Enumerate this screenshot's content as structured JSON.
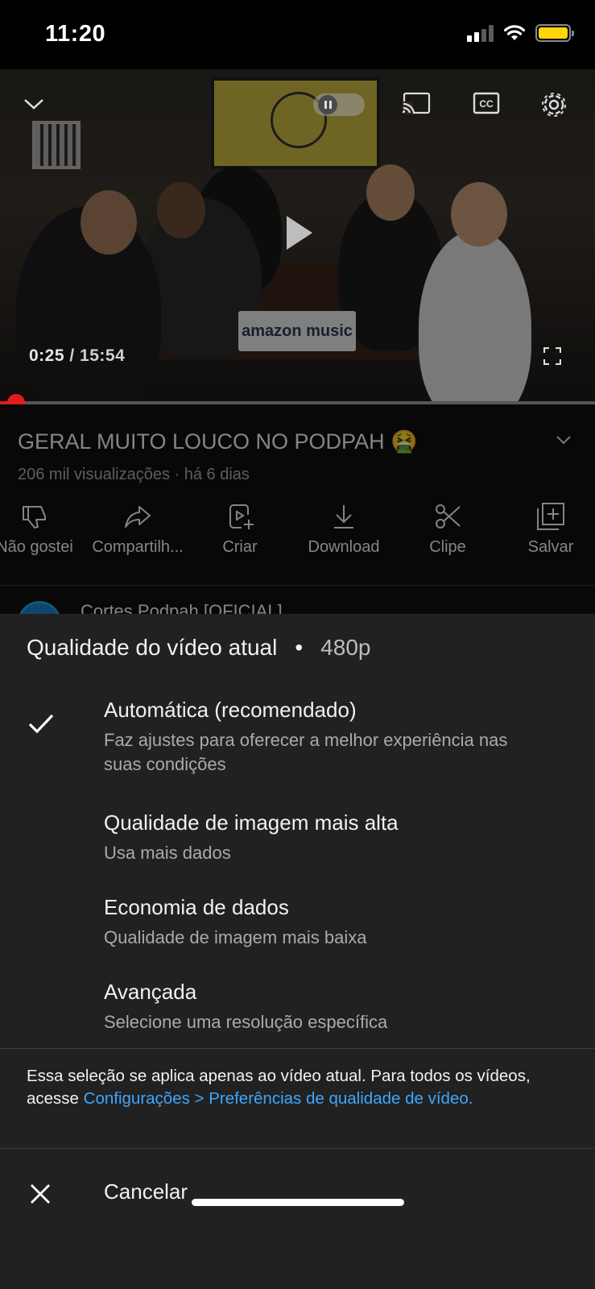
{
  "status_bar": {
    "time": "11:20"
  },
  "player": {
    "current_time": "0:25",
    "separator": " / ",
    "duration": "15:54",
    "progress_fraction": 0.027,
    "sign_text": "amazon music"
  },
  "video": {
    "title": "GERAL MUITO LOUCO NO PODPAH 🤮",
    "meta": "206 mil visualizações · há 6 dias",
    "actions": [
      {
        "label": "Não gostei",
        "icon": "thumbs-down-icon"
      },
      {
        "label": "Compartilh...",
        "icon": "share-icon"
      },
      {
        "label": "Criar",
        "icon": "create-icon"
      },
      {
        "label": "Download",
        "icon": "download-icon"
      },
      {
        "label": "Clipe",
        "icon": "scissors-icon"
      },
      {
        "label": "Salvar",
        "icon": "save-playlist-icon"
      }
    ],
    "channel_name": "Cortes Podpah [OFICIAL]"
  },
  "quality_sheet": {
    "header_label": "Qualidade do vídeo atual",
    "header_dot": "•",
    "current_quality": "480p",
    "options": [
      {
        "title": "Automática (recomendado)",
        "description": "Faz ajustes para oferecer a melhor experiência nas suas condições",
        "selected": true
      },
      {
        "title": "Qualidade de imagem mais alta",
        "description": "Usa mais dados",
        "selected": false
      },
      {
        "title": "Economia de dados",
        "description": "Qualidade de imagem mais baixa",
        "selected": false
      },
      {
        "title": "Avançada",
        "description": "Selecione uma resolução específica",
        "selected": false
      }
    ],
    "note_text": "Essa seleção se aplica apenas ao vídeo atual. Para todos os vídeos, acesse ",
    "note_link": "Configurações > Preferências de qualidade de vídeo.",
    "cancel_label": "Cancelar"
  },
  "colors": {
    "accent_red": "#e21d1d",
    "link_blue": "#3ea6ff",
    "sheet_bg": "#212121",
    "battery_yellow": "#ffd60a"
  }
}
